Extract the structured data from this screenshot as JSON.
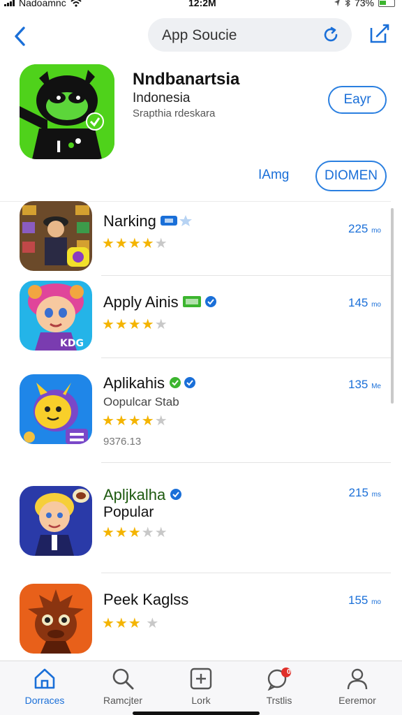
{
  "status_bar": {
    "carrier": "Nadoamnc",
    "time": "12:2M",
    "battery": "73%"
  },
  "search": {
    "placeholder": "App Soucie"
  },
  "featured": {
    "name": "Nndbanartsia",
    "subtitle": "Indonesia",
    "subtitle2": "Srapthia rdeskara",
    "get_label": "Eayr",
    "link_label": "IAmg",
    "open_label": "DIOMEN",
    "icon": "cat-mascot-icon",
    "accent": "#4fd21b"
  },
  "apps": [
    {
      "name": "Narking",
      "rating": 4,
      "size": "225",
      "size_unit": "mo",
      "icon": "game-poster-icon",
      "badge": "blue-chip"
    },
    {
      "name": "Apply Ainis",
      "rating": 4,
      "size": "145",
      "size_unit": "mo",
      "icon": "pink-hair-character-icon",
      "badge": "green-chip"
    },
    {
      "name": "Aplikahis",
      "subtitle": "Oopulcar Stab",
      "extra": "9376.13",
      "rating": 4,
      "size": "135",
      "size_unit": "Me",
      "icon": "yellow-creature-icon",
      "badge": "green-check"
    },
    {
      "name": "Apljkalha",
      "subtitle": "Popular",
      "rating": 3,
      "size": "215",
      "size_unit": "ms",
      "icon": "blonde-boy-icon",
      "badge": "blue-check"
    },
    {
      "name": "Peek Kaglss",
      "rating": 3,
      "size": "155",
      "size_unit": "mo",
      "icon": "spiky-monster-icon",
      "badge": "none"
    }
  ],
  "tabs": [
    {
      "label": "Dorraces",
      "icon": "home-icon",
      "active": true
    },
    {
      "label": "Ramcjter",
      "icon": "search-icon",
      "active": false
    },
    {
      "label": "Lork",
      "icon": "plus-square-icon",
      "active": false
    },
    {
      "label": "Trstlis",
      "icon": "chat-bubble-icon",
      "active": false,
      "badge_count": "0"
    },
    {
      "label": "Eeremor",
      "icon": "person-icon",
      "active": false
    }
  ],
  "colors": {
    "accent_blue": "#1a6fd8",
    "star": "#f4b400",
    "green_check": "#3cb52f"
  }
}
